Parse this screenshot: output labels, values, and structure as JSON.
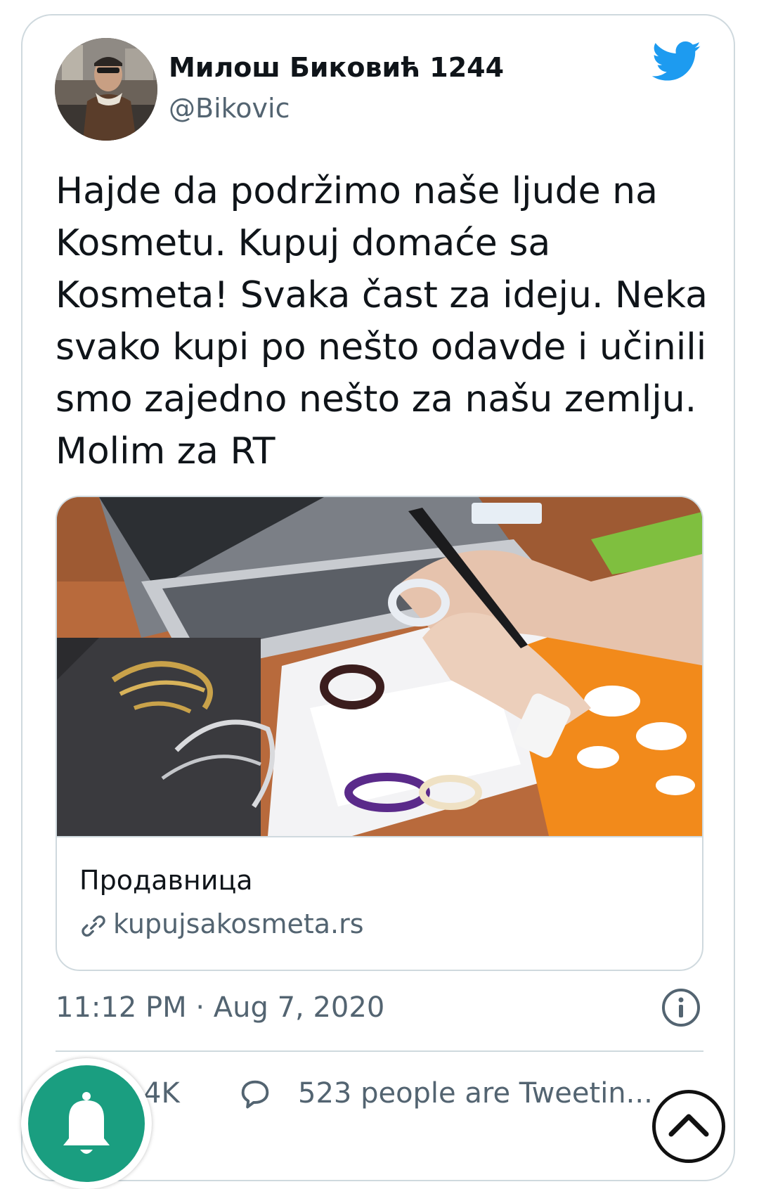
{
  "tweet": {
    "author_name": "Милош Биковић 1244",
    "author_handle": "@Bikovic",
    "text": "Hajde da podržimo naše ljude na\nKosmetu. Kupuj domaće sa\nKosmeta! Svaka čast za ideju. Neka\nsvako kupi po nešto odavde i učinili\nsmo zajedno nešto za našu zemlju.\nMolim za RT",
    "timestamp": "11:12 PM · Aug 7, 2020"
  },
  "link_card": {
    "title": "Продавница",
    "domain": "kupujsakosmeta.rs"
  },
  "actions": {
    "likes": "4K",
    "tweeting": "523 people are Tweetin..."
  },
  "colors": {
    "twitter_blue": "#1d9bf0",
    "fab_green": "#1a9e80",
    "secondary_text": "#536471",
    "border": "#cfd9de"
  },
  "icons": {
    "brand": "twitter-bird-icon",
    "link": "link-icon",
    "info": "info-icon",
    "reply": "reply-icon",
    "fab": "bell-icon",
    "scroll": "chevron-up-icon"
  }
}
